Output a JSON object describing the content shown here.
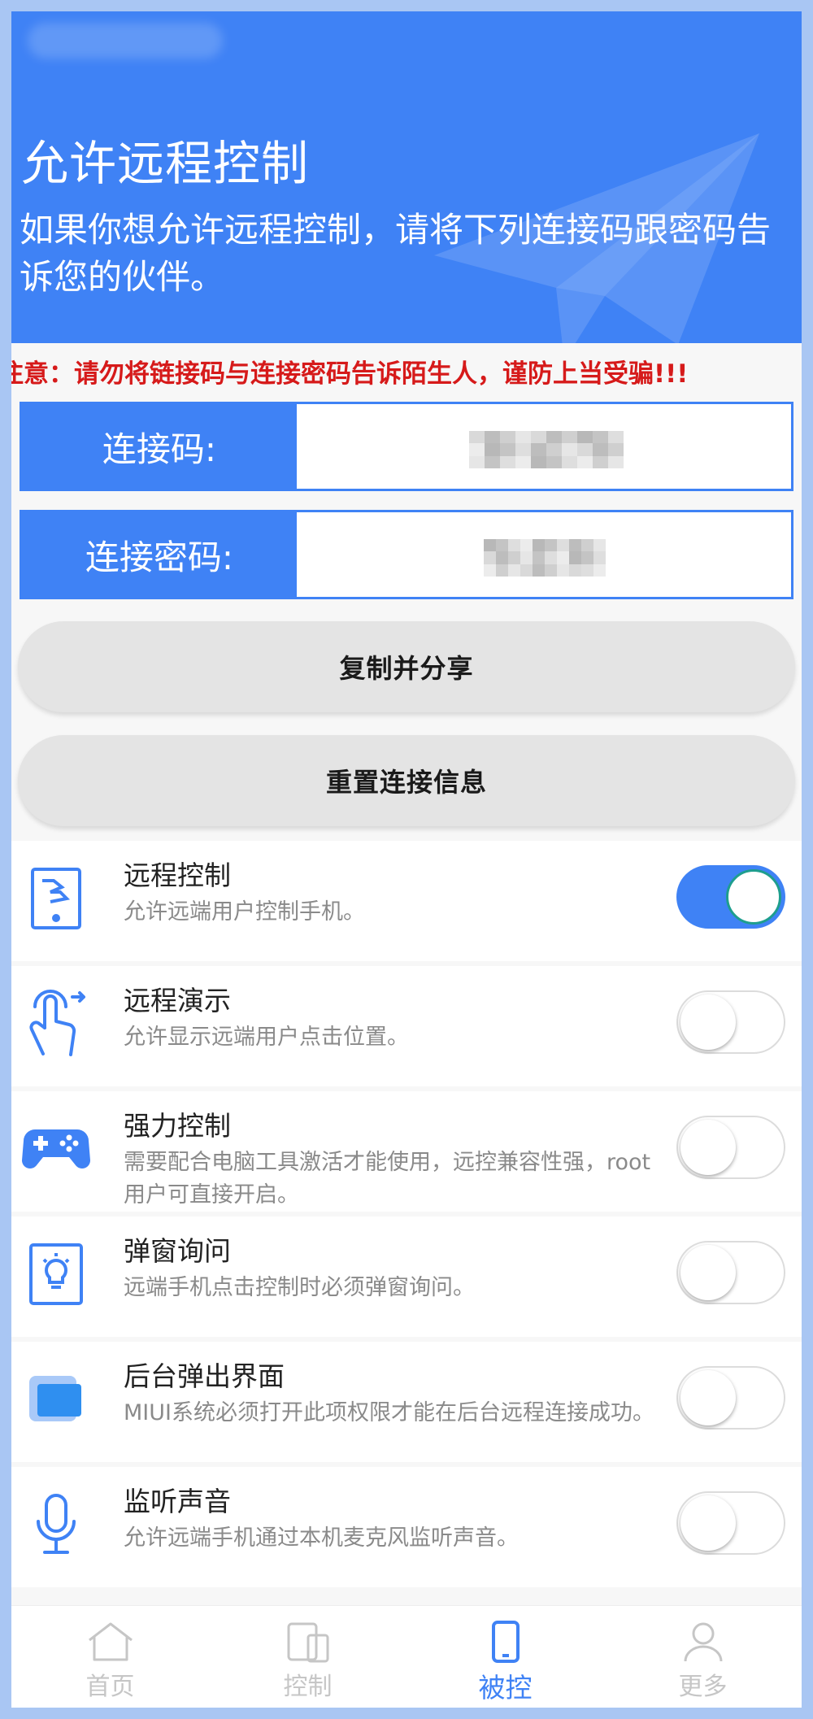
{
  "header": {
    "title": "允许远程控制",
    "description": "如果你想允许远程控制，请将下列连接码跟密码告诉您的伙伴。"
  },
  "warning": "注意：请勿将链接码与连接密码告诉陌生人，谨防上当受骗!!!",
  "connection": {
    "code_label": "连接码:",
    "password_label": "连接密码:"
  },
  "buttons": {
    "copy_share": "复制并分享",
    "reset": "重置连接信息"
  },
  "settings": [
    {
      "title": "远程控制",
      "subtitle": "允许远端用户控制手机。",
      "enabled": true,
      "icon": "remote-control-icon"
    },
    {
      "title": "远程演示",
      "subtitle": "允许显示远端用户点击位置。",
      "enabled": false,
      "icon": "tap-gesture-icon"
    },
    {
      "title": "强力控制",
      "subtitle": "需要配合电脑工具激活才能使用，远控兼容性强，root用户可直接开启。",
      "enabled": false,
      "icon": "gamepad-icon"
    },
    {
      "title": "弹窗询问",
      "subtitle": "远端手机点击控制时必须弹窗询问。",
      "enabled": false,
      "icon": "lightbulb-icon"
    },
    {
      "title": "后台弹出界面",
      "subtitle": "MIUI系统必须打开此项权限才能在后台远程连接成功。",
      "enabled": false,
      "icon": "window-icon"
    },
    {
      "title": "监听声音",
      "subtitle": "允许远端手机通过本机麦克风监听声音。",
      "enabled": false,
      "icon": "microphone-icon"
    }
  ],
  "tabs": [
    {
      "label": "首页",
      "icon": "home-icon",
      "active": false
    },
    {
      "label": "控制",
      "icon": "devices-icon",
      "active": false
    },
    {
      "label": "被控",
      "icon": "phone-icon",
      "active": true
    },
    {
      "label": "更多",
      "icon": "user-icon",
      "active": false
    }
  ],
  "colors": {
    "primary": "#3f82f5",
    "warning": "#d61a1a",
    "toggle_knob_border": "#1e9e8e"
  }
}
